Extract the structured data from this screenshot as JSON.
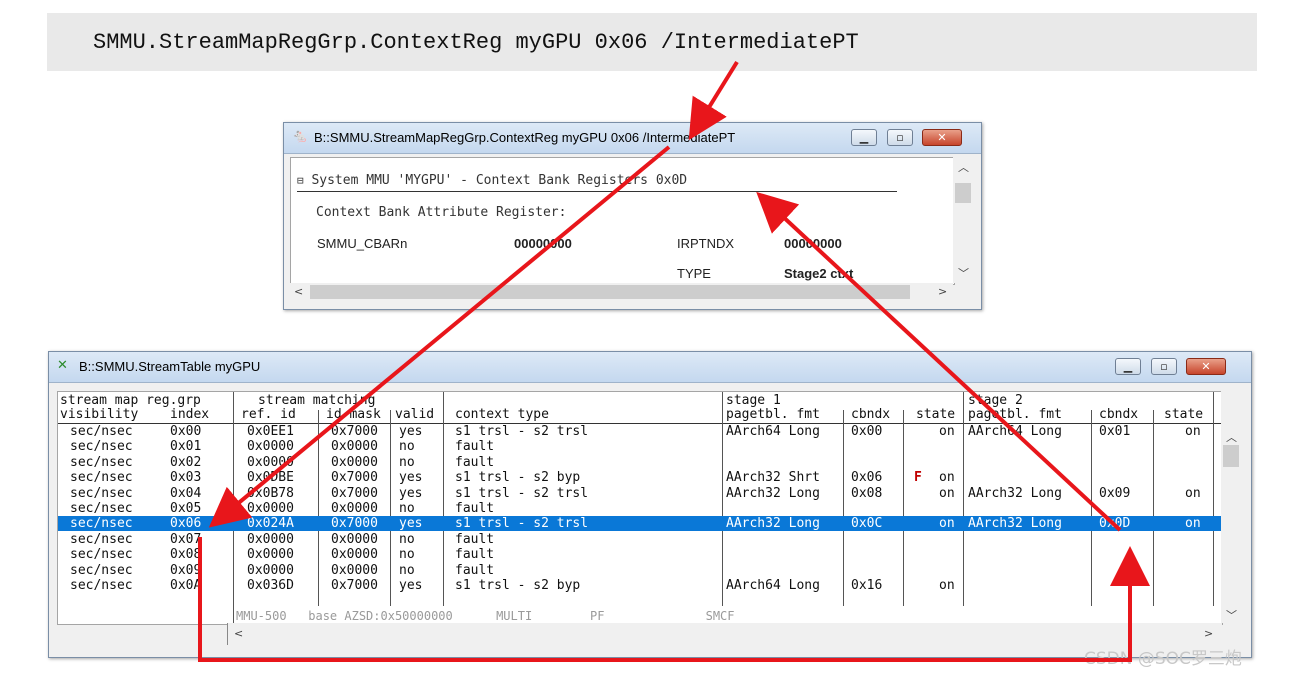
{
  "command": "SMMU.StreamMapRegGrp.ContextReg myGPU 0x06 /IntermediatePT",
  "context_window": {
    "title": "B::SMMU.StreamMapRegGrp.ContextReg myGPU 0x06 /IntermediatePT",
    "heading": "System MMU 'MYGPU' - Context Bank Registers 0x0D",
    "subheading": "Context Bank Attribute Register:",
    "register_name": "SMMU_CBARn",
    "register_value": "00000000",
    "field1_name": "IRPTNDX",
    "field1_value": "00000000",
    "field2_name": "TYPE",
    "field2_value": "Stage2 ctxt"
  },
  "stream_window": {
    "title": "B::SMMU.StreamTable myGPU",
    "headers": {
      "line1": {
        "a": "stream map reg.grp",
        "b": "stream matching",
        "c": "stage 1",
        "d": "stage 2"
      },
      "line2": {
        "visibility": "visibility",
        "index": "index",
        "ref_id": "ref. id",
        "id_mask": "id mask",
        "valid": "valid",
        "context_type": "context type",
        "s1_fmt": "pagetbl. fmt",
        "s1_cbndx": "cbndx",
        "s1_state": "state",
        "s2_fmt": "pagetbl. fmt",
        "s2_cbndx": "cbndx",
        "s2_state": "state"
      }
    },
    "rows": [
      {
        "vis": "sec/nsec",
        "idx": "0x00",
        "ref": "0x0EE1",
        "mask": "0x7000",
        "valid": "yes",
        "ctx": "s1 trsl - s2 trsl",
        "s1fmt": "AArch64 Long",
        "s1cb": "0x00",
        "flag": "",
        "s1st": "on",
        "s2fmt": "AArch64 Long",
        "s2cb": "0x01",
        "s2st": "on"
      },
      {
        "vis": "sec/nsec",
        "idx": "0x01",
        "ref": "0x0000",
        "mask": "0x0000",
        "valid": "no",
        "ctx": "fault",
        "s1fmt": "",
        "s1cb": "",
        "flag": "",
        "s1st": "",
        "s2fmt": "",
        "s2cb": "",
        "s2st": ""
      },
      {
        "vis": "sec/nsec",
        "idx": "0x02",
        "ref": "0x0000",
        "mask": "0x0000",
        "valid": "no",
        "ctx": "fault",
        "s1fmt": "",
        "s1cb": "",
        "flag": "",
        "s1st": "",
        "s2fmt": "",
        "s2cb": "",
        "s2st": ""
      },
      {
        "vis": "sec/nsec",
        "idx": "0x03",
        "ref": "0x0DBE",
        "mask": "0x7000",
        "valid": "yes",
        "ctx": "s1 trsl - s2 byp",
        "s1fmt": "AArch32 Shrt",
        "s1cb": "0x06",
        "flag": "F",
        "s1st": "on",
        "s2fmt": "",
        "s2cb": "",
        "s2st": ""
      },
      {
        "vis": "sec/nsec",
        "idx": "0x04",
        "ref": "0x0B78",
        "mask": "0x7000",
        "valid": "yes",
        "ctx": "s1 trsl - s2 trsl",
        "s1fmt": "AArch32 Long",
        "s1cb": "0x08",
        "flag": "",
        "s1st": "on",
        "s2fmt": "AArch32 Long",
        "s2cb": "0x09",
        "s2st": "on"
      },
      {
        "vis": "sec/nsec",
        "idx": "0x05",
        "ref": "0x0000",
        "mask": "0x0000",
        "valid": "no",
        "ctx": "fault",
        "s1fmt": "",
        "s1cb": "",
        "flag": "",
        "s1st": "",
        "s2fmt": "",
        "s2cb": "",
        "s2st": ""
      },
      {
        "vis": "sec/nsec",
        "idx": "0x06",
        "ref": "0x024A",
        "mask": "0x7000",
        "valid": "yes",
        "ctx": "s1 trsl - s2 trsl",
        "s1fmt": "AArch32 Long",
        "s1cb": "0x0C",
        "flag": "",
        "s1st": "on",
        "s2fmt": "AArch32 Long",
        "s2cb": "0x0D",
        "s2st": "on",
        "selected": true
      },
      {
        "vis": "sec/nsec",
        "idx": "0x07",
        "ref": "0x0000",
        "mask": "0x0000",
        "valid": "no",
        "ctx": "fault",
        "s1fmt": "",
        "s1cb": "",
        "flag": "",
        "s1st": "",
        "s2fmt": "",
        "s2cb": "",
        "s2st": ""
      },
      {
        "vis": "sec/nsec",
        "idx": "0x08",
        "ref": "0x0000",
        "mask": "0x0000",
        "valid": "no",
        "ctx": "fault",
        "s1fmt": "",
        "s1cb": "",
        "flag": "",
        "s1st": "",
        "s2fmt": "",
        "s2cb": "",
        "s2st": ""
      },
      {
        "vis": "sec/nsec",
        "idx": "0x09",
        "ref": "0x0000",
        "mask": "0x0000",
        "valid": "no",
        "ctx": "fault",
        "s1fmt": "",
        "s1cb": "",
        "flag": "",
        "s1st": "",
        "s2fmt": "",
        "s2cb": "",
        "s2st": ""
      },
      {
        "vis": "sec/nsec",
        "idx": "0x0A",
        "ref": "0x036D",
        "mask": "0x7000",
        "valid": "yes",
        "ctx": "s1 trsl - s2 byp",
        "s1fmt": "AArch64 Long",
        "s1cb": "0x16",
        "flag": "",
        "s1st": "on",
        "s2fmt": "",
        "s2cb": "",
        "s2st": ""
      }
    ],
    "status_line": "MMU-500   base AZSD:0x50000000      MULTI        PF              SMCF"
  },
  "watermark": "CSDN @SOC罗三炮",
  "colors": {
    "arrow": "#e8161b",
    "selection": "#0a78d7",
    "fault_flag": "#c00000"
  }
}
